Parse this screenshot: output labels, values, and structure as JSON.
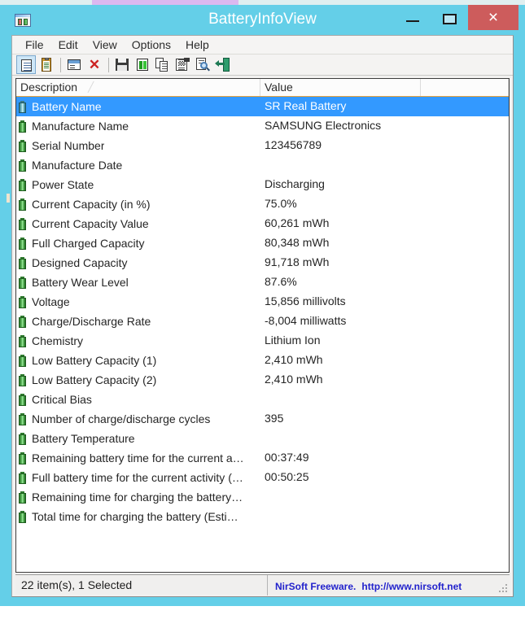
{
  "window": {
    "title": "BatteryInfoView",
    "app_icon": "battery-window-icon",
    "controls": {
      "minimize_label": "minimize-icon",
      "maximize_label": "maximize-icon",
      "close_label": "×"
    }
  },
  "menubar": {
    "items": [
      {
        "label": "File"
      },
      {
        "label": "Edit"
      },
      {
        "label": "View"
      },
      {
        "label": "Options"
      },
      {
        "label": "Help"
      }
    ]
  },
  "toolbar": {
    "buttons": [
      {
        "name": "battery-information-view",
        "icon": "document-lines-icon",
        "active": true
      },
      {
        "name": "battery-log-view",
        "icon": "clipboard-icon",
        "active": false
      },
      {
        "name": "properties",
        "icon": "properties-window-icon",
        "active": false
      },
      {
        "name": "clear-log",
        "icon": "red-x-icon",
        "active": false
      },
      {
        "name": "save-selected-items",
        "icon": "floppy-save-icon",
        "active": false
      },
      {
        "name": "refresh",
        "icon": "refresh-arrows-icon",
        "active": false
      },
      {
        "name": "copy-selected-items",
        "icon": "copy-pages-icon",
        "active": false
      },
      {
        "name": "html-report",
        "icon": "html-report-icon",
        "active": false
      },
      {
        "name": "find",
        "icon": "magnifier-page-icon",
        "active": false
      },
      {
        "name": "exit",
        "icon": "exit-door-icon",
        "active": false
      }
    ]
  },
  "listview": {
    "columns": [
      {
        "label": "Description",
        "key": "description",
        "sorted": true,
        "sort_mark": "╱"
      },
      {
        "label": "Value",
        "key": "value",
        "sorted": false,
        "sort_mark": ""
      },
      {
        "label": "",
        "key": "extra",
        "sorted": false,
        "sort_mark": ""
      }
    ],
    "rows": [
      {
        "icon": "battery-icon",
        "description": "Battery Name",
        "value": "SR Real Battery",
        "selected": true
      },
      {
        "icon": "battery-icon",
        "description": "Manufacture Name",
        "value": "SAMSUNG Electronics",
        "selected": false
      },
      {
        "icon": "battery-icon",
        "description": "Serial Number",
        "value": "123456789",
        "selected": false
      },
      {
        "icon": "battery-icon",
        "description": "Manufacture Date",
        "value": "",
        "selected": false
      },
      {
        "icon": "battery-icon",
        "description": "Power State",
        "value": "Discharging",
        "selected": false
      },
      {
        "icon": "battery-icon",
        "description": "Current Capacity (in %)",
        "value": "75.0%",
        "selected": false
      },
      {
        "icon": "battery-icon",
        "description": "Current Capacity Value",
        "value": "60,261 mWh",
        "selected": false
      },
      {
        "icon": "battery-icon",
        "description": "Full Charged Capacity",
        "value": "80,348 mWh",
        "selected": false
      },
      {
        "icon": "battery-icon",
        "description": "Designed Capacity",
        "value": "91,718 mWh",
        "selected": false
      },
      {
        "icon": "battery-icon",
        "description": "Battery Wear Level",
        "value": "87.6%",
        "selected": false
      },
      {
        "icon": "battery-icon",
        "description": "Voltage",
        "value": "15,856 millivolts",
        "selected": false
      },
      {
        "icon": "battery-icon",
        "description": "Charge/Discharge Rate",
        "value": "-8,004 milliwatts",
        "selected": false
      },
      {
        "icon": "battery-icon",
        "description": "Chemistry",
        "value": "Lithium Ion",
        "selected": false
      },
      {
        "icon": "battery-icon",
        "description": "Low Battery Capacity (1)",
        "value": "2,410 mWh",
        "selected": false
      },
      {
        "icon": "battery-icon",
        "description": "Low Battery Capacity (2)",
        "value": "2,410 mWh",
        "selected": false
      },
      {
        "icon": "battery-icon",
        "description": "Critical Bias",
        "value": "",
        "selected": false
      },
      {
        "icon": "battery-icon",
        "description": "Number of charge/discharge cycles",
        "value": "395",
        "selected": false
      },
      {
        "icon": "battery-icon",
        "description": "Battery Temperature",
        "value": "",
        "selected": false
      },
      {
        "icon": "battery-icon",
        "description": "Remaining battery time for the current a…",
        "value": "00:37:49",
        "selected": false
      },
      {
        "icon": "battery-icon",
        "description": "Full battery time for the current activity (…",
        "value": "00:50:25",
        "selected": false
      },
      {
        "icon": "battery-icon",
        "description": "Remaining time for charging the battery…",
        "value": "",
        "selected": false
      },
      {
        "icon": "battery-icon",
        "description": "Total  time for charging the battery (Esti…",
        "value": "",
        "selected": false
      }
    ]
  },
  "statusbar": {
    "items_text": "22 item(s), 1 Selected",
    "credit_text": "NirSoft Freeware.",
    "credit_url": "http://www.nirsoft.net"
  },
  "colors": {
    "titlebar": "#64cfe8",
    "close_button": "#cd5c5c",
    "selection": "#3399ff",
    "header_underline": "#e6a13c",
    "credit_link": "#2222cc",
    "battery_green": "#4aa84a"
  }
}
